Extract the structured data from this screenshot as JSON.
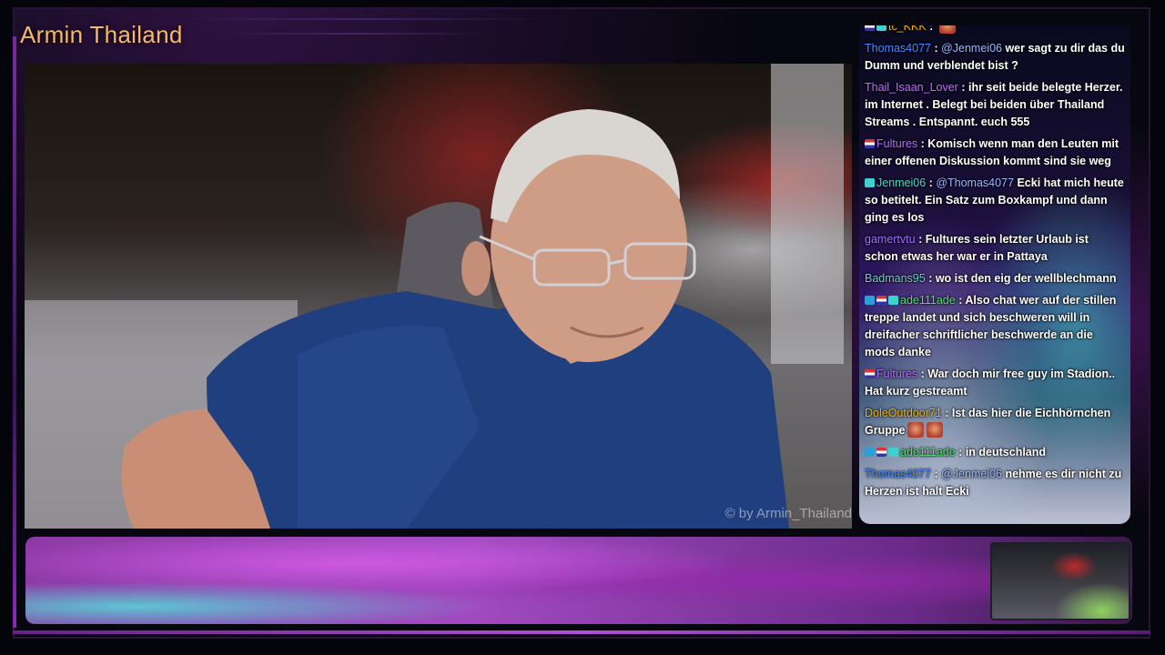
{
  "stream": {
    "title": "Armin Thailand",
    "watermark": "© by Armin_Thailand"
  },
  "chat": {
    "messages": [
      {
        "badges": [
          "flag",
          "sub"
        ],
        "user": "tc_KKK",
        "user_color": "#f5b800",
        "text": "",
        "emotes": 1
      },
      {
        "badges": [],
        "user": "Thomas4077",
        "user_color": "#4a8cff",
        "mention": "@Jenmei06",
        "text": "wer sagt zu dir das du Dumm und verblendet bist ?"
      },
      {
        "badges": [],
        "user": "Thail_Isaan_Lover",
        "user_color": "#c06cff",
        "text": "ihr seit beide belegte Herzer. im Internet . Belegt bei beiden über Thailand Streams . Entspannt. euch 555"
      },
      {
        "badges": [
          "flag"
        ],
        "user": "Fultures",
        "user_color": "#b070ff",
        "text": "Komisch wenn man den Leuten mit einer offenen Diskussion kommt sind sie weg"
      },
      {
        "badges": [
          "sub"
        ],
        "user": "Jenmei06",
        "user_color": "#4fd6c8",
        "mention": "@Thomas4077",
        "text": "Ecki hat mich heute so betitelt. Ein Satz zum Boxkampf und dann ging es los"
      },
      {
        "badges": [],
        "user": "gamertvtu",
        "user_color": "#a070ff",
        "text": "Fultures sein letzter Urlaub ist schon etwas her war er in Pattaya"
      },
      {
        "badges": [],
        "user": "Badmans95",
        "user_color": "#6ad0c0",
        "text": "wo ist den eig der wellblechmann"
      },
      {
        "badges": [
          "prime",
          "flag",
          "sub"
        ],
        "user": "ade111ade",
        "user_color": "#4fe070",
        "text": "Also chat wer auf der stillen treppe landet und sich beschweren will in dreifacher schriftlicher beschwerde an die mods danke"
      },
      {
        "badges": [
          "flag"
        ],
        "user": "Fultures",
        "user_color": "#b070ff",
        "text": "War doch mir free guy im Stadion.. Hat kurz gestreamt"
      },
      {
        "badges": [],
        "user": "DoleOutdoor71",
        "user_color": "#f5b800",
        "text": "Ist das hier die Eichhörnchen Gruppe",
        "emotes": 2
      },
      {
        "badges": [
          "prime",
          "flag",
          "sub"
        ],
        "user": "ade111ade",
        "user_color": "#4fe070",
        "text": "in deutschland"
      },
      {
        "badges": [],
        "user": "Thomas4077",
        "user_color": "#4a8cff",
        "mention": "@Jenmei06",
        "text": "nehme es dir nicht zu Herzen ist halt Ecki"
      }
    ]
  }
}
